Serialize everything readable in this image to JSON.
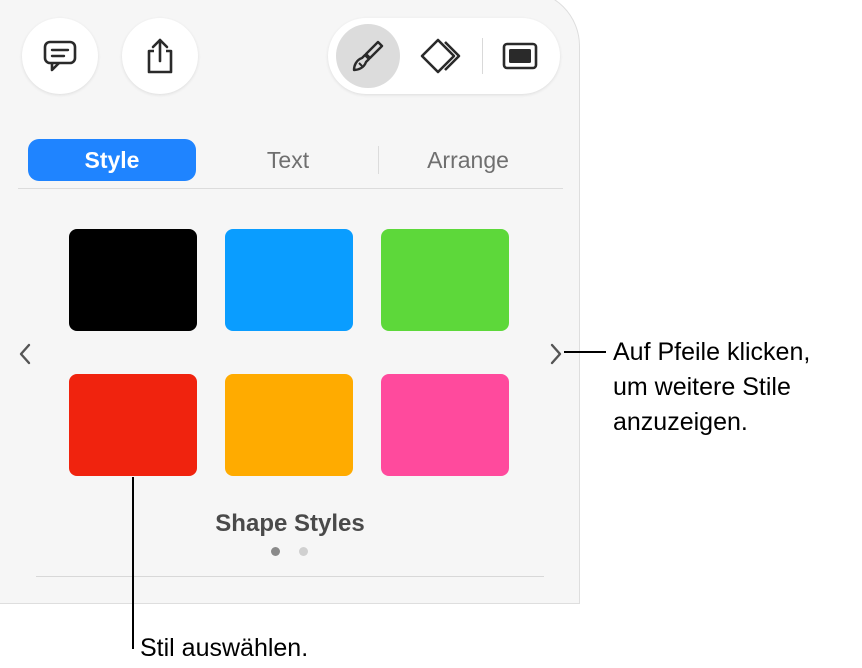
{
  "tabs": [
    {
      "label": "Style",
      "active": true
    },
    {
      "label": "Text",
      "active": false
    },
    {
      "label": "Arrange",
      "active": false
    }
  ],
  "swatches": [
    {
      "name": "black",
      "color": "#000000"
    },
    {
      "name": "blue",
      "color": "#0a9dff"
    },
    {
      "name": "green",
      "color": "#5dd83a"
    },
    {
      "name": "red",
      "color": "#f0230e"
    },
    {
      "name": "orange",
      "color": "#ffab00"
    },
    {
      "name": "pink",
      "color": "#ff4a9d"
    }
  ],
  "section_label": "Shape Styles",
  "page_dots": {
    "count": 2,
    "active_index": 0
  },
  "toolbar_icons": [
    "comment-icon",
    "share-icon",
    "paintbrush-icon",
    "diamond-icon",
    "slide-icon"
  ],
  "callouts": {
    "arrows_line1": "Auf Pfeile klicken,",
    "arrows_line2": "um weitere Stile",
    "arrows_line3": "anzuzeigen.",
    "select": "Stil auswählen."
  },
  "colors": {
    "accent": "#1f84ff",
    "panel_bg": "#f6f6f6"
  }
}
